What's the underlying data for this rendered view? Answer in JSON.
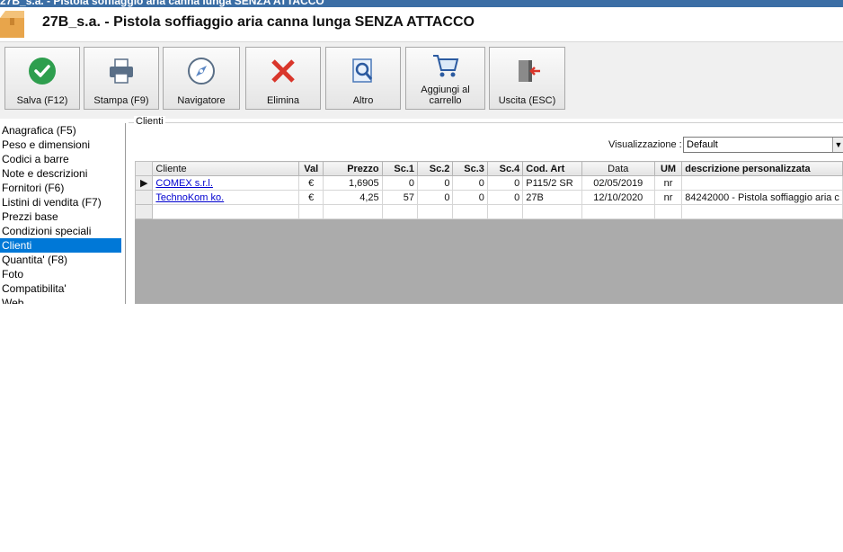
{
  "window": {
    "title": "27B_s.a. - Pistola soffiaggio aria canna lunga SENZA ATTACCO"
  },
  "header": {
    "title": "27B_s.a. - Pistola soffiaggio aria canna lunga SENZA ATTACCO"
  },
  "toolbar": {
    "buttons": [
      {
        "label": "Salva (F12)",
        "icon": "checkmark-icon"
      },
      {
        "label": "Stampa (F9)",
        "icon": "printer-icon"
      },
      {
        "label": "Navigatore",
        "icon": "compass-icon"
      },
      {
        "label": "Elimina",
        "icon": "delete-x-icon"
      },
      {
        "label": "Altro",
        "icon": "magnifier-document-icon"
      },
      {
        "label": "Aggiungi al carrello",
        "icon": "cart-icon"
      },
      {
        "label": "Uscita (ESC)",
        "icon": "exit-door-icon"
      }
    ]
  },
  "sidebar": {
    "items": [
      {
        "label": "Anagrafica (F5)"
      },
      {
        "label": "Peso e dimensioni"
      },
      {
        "label": "Codici a barre"
      },
      {
        "label": "Note e descrizioni"
      },
      {
        "label": "Fornitori (F6)"
      },
      {
        "label": "Listini di vendita (F7)"
      },
      {
        "label": "Prezzi base"
      },
      {
        "label": "Condizioni speciali"
      },
      {
        "label": "Clienti"
      },
      {
        "label": "Quantita' (F8)"
      },
      {
        "label": "Foto"
      },
      {
        "label": "Compatibilita'"
      },
      {
        "label": "Web"
      }
    ],
    "selected": "Clienti"
  },
  "clienti": {
    "group_label": "Clienti",
    "view_label": "Visualizzazione :",
    "view_value": "Default",
    "columns": [
      "Cliente",
      "Val",
      "Prezzo",
      "Sc.1",
      "Sc.2",
      "Sc.3",
      "Sc.4",
      "Cod. Art",
      "Data",
      "UM",
      "descrizione personalizzata"
    ],
    "rows": [
      [
        "COMEX s.r.l.",
        "€",
        "1,6905",
        "0",
        "0",
        "0",
        "0",
        "P115/2 SR",
        "02/05/2019",
        "nr",
        ""
      ],
      [
        "TechnoKom ko.",
        "€",
        "4,25",
        "57",
        "0",
        "0",
        "0",
        "27B",
        "12/10/2020",
        "nr",
        "84242000 - Pistola soffiaggio aria c"
      ]
    ]
  },
  "colors": {
    "selection": "#0078d7",
    "grid_empty": "#ababab",
    "titlebar": "#3b6ea5"
  }
}
